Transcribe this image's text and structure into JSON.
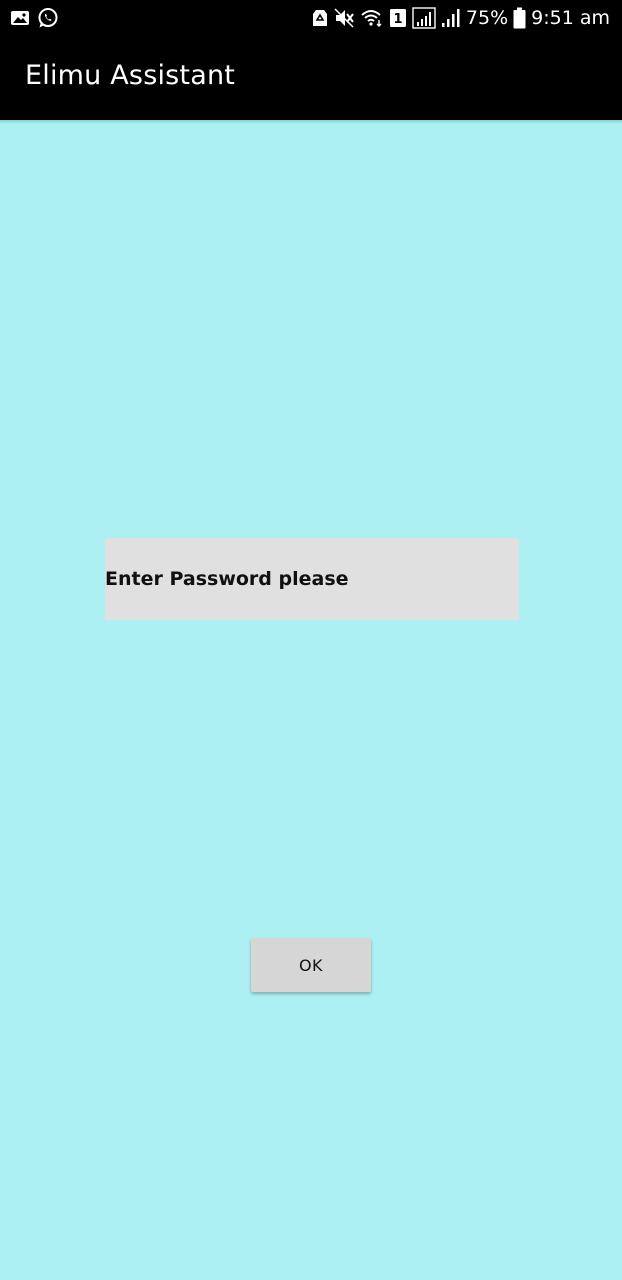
{
  "status_bar": {
    "battery_percent": "75%",
    "time": "9:51 am",
    "sim_slot": "1",
    "icons_left": [
      "gallery-icon",
      "whatsapp-icon"
    ],
    "icons_right": [
      "recycle-icon",
      "mute-icon",
      "wifi-icon",
      "sim-1-icon",
      "signal-1-icon",
      "signal-2-icon",
      "battery-icon"
    ]
  },
  "app_bar": {
    "title": "Elimu Assistant"
  },
  "password_field": {
    "placeholder": "Enter Password please",
    "value": ""
  },
  "ok_button": {
    "label": "OK"
  },
  "colors": {
    "background": "#adf0f3",
    "app_bar": "#000000",
    "field_background": "#e0e0e0",
    "button_background": "#d6d6d6"
  }
}
